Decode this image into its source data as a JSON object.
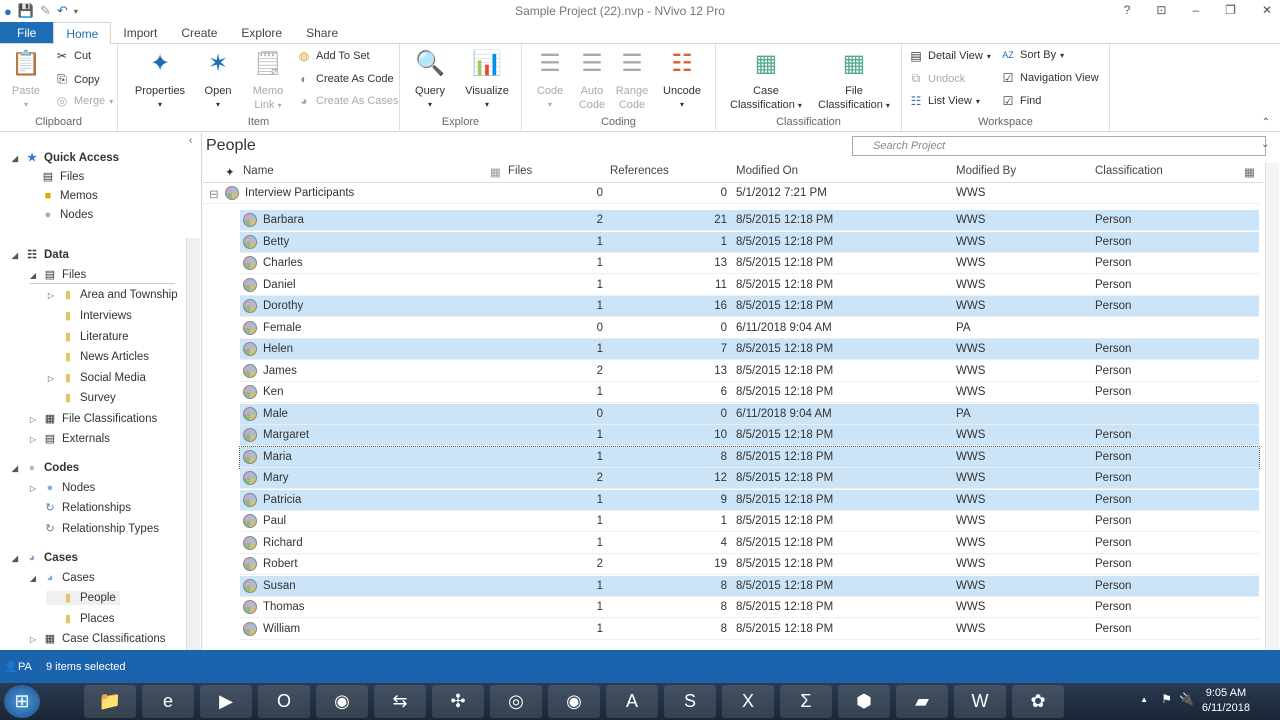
{
  "window": {
    "title": "Sample Project (22).nvp - NVivo 12 Pro",
    "help": "?",
    "minimize": "–",
    "restore": "❐",
    "close": "✕",
    "ribbon_display": "⊡"
  },
  "tabs": [
    "File",
    "Home",
    "Import",
    "Create",
    "Explore",
    "Share"
  ],
  "ribbon": {
    "clipboard": {
      "label": "Clipboard",
      "paste": "Paste",
      "cut": "Cut",
      "copy": "Copy",
      "merge": "Merge"
    },
    "item": {
      "label": "Item",
      "properties": "Properties",
      "open": "Open",
      "memo_link_1": "Memo",
      "memo_link_2": "Link",
      "add_to_set": "Add To Set",
      "create_as_code": "Create As Code",
      "create_as_cases": "Create As Cases"
    },
    "explore": {
      "label": "Explore",
      "query": "Query",
      "visualize": "Visualize"
    },
    "coding": {
      "label": "Coding",
      "code": "Code",
      "auto_code_1": "Auto",
      "auto_code_2": "Code",
      "range_code_1": "Range",
      "range_code_2": "Code",
      "uncode": "Uncode"
    },
    "classification": {
      "label": "Classification",
      "case_1": "Case",
      "case_2": "Classification",
      "file_1": "File",
      "file_2": "Classification"
    },
    "workspace": {
      "label": "Workspace",
      "detail_view": "Detail View",
      "sort_by": "Sort By",
      "undock": "Undock",
      "navigation_view": "Navigation View",
      "list_view": "List View",
      "find": "Find"
    }
  },
  "nav": {
    "quick_access": "Quick Access",
    "qa_files": "Files",
    "qa_memos": "Memos",
    "qa_nodes": "Nodes",
    "data": "Data",
    "files": "Files",
    "folders": [
      "Area and Township",
      "Interviews",
      "Literature",
      "News Articles",
      "Social Media",
      "Survey"
    ],
    "file_classifications": "File Classifications",
    "externals": "Externals",
    "codes": "Codes",
    "nodes": "Nodes",
    "relationships": "Relationships",
    "relationship_types": "Relationship Types",
    "cases": "Cases",
    "cases_sub": "Cases",
    "people": "People",
    "places": "Places",
    "case_classifications": "Case Classifications"
  },
  "main": {
    "title": "People",
    "search_placeholder": "Search Project",
    "columns": [
      "Name",
      "Files",
      "References",
      "Modified On",
      "Modified By",
      "Classification"
    ],
    "parent": {
      "name": "Interview Participants",
      "files": "0",
      "refs": "0",
      "modified_on": "5/1/2012 7:21 PM",
      "modified_by": "WWS",
      "classification": ""
    },
    "rows": [
      {
        "name": "Barbara",
        "files": "2",
        "refs": "21",
        "modified_on": "8/5/2015 12:18 PM",
        "modified_by": "WWS",
        "classification": "Person",
        "selected": true
      },
      {
        "name": "Betty",
        "files": "1",
        "refs": "1",
        "modified_on": "8/5/2015 12:18 PM",
        "modified_by": "WWS",
        "classification": "Person",
        "selected": true
      },
      {
        "name": "Charles",
        "files": "1",
        "refs": "13",
        "modified_on": "8/5/2015 12:18 PM",
        "modified_by": "WWS",
        "classification": "Person",
        "selected": false
      },
      {
        "name": "Daniel",
        "files": "1",
        "refs": "11",
        "modified_on": "8/5/2015 12:18 PM",
        "modified_by": "WWS",
        "classification": "Person",
        "selected": false
      },
      {
        "name": "Dorothy",
        "files": "1",
        "refs": "16",
        "modified_on": "8/5/2015 12:18 PM",
        "modified_by": "WWS",
        "classification": "Person",
        "selected": true
      },
      {
        "name": "Female",
        "files": "0",
        "refs": "0",
        "modified_on": "6/11/2018 9:04 AM",
        "modified_by": "PA",
        "classification": "",
        "selected": false
      },
      {
        "name": "Helen",
        "files": "1",
        "refs": "7",
        "modified_on": "8/5/2015 12:18 PM",
        "modified_by": "WWS",
        "classification": "Person",
        "selected": true
      },
      {
        "name": "James",
        "files": "2",
        "refs": "13",
        "modified_on": "8/5/2015 12:18 PM",
        "modified_by": "WWS",
        "classification": "Person",
        "selected": false
      },
      {
        "name": "Ken",
        "files": "1",
        "refs": "6",
        "modified_on": "8/5/2015 12:18 PM",
        "modified_by": "WWS",
        "classification": "Person",
        "selected": false
      },
      {
        "name": "Male",
        "files": "0",
        "refs": "0",
        "modified_on": "6/11/2018 9:04 AM",
        "modified_by": "PA",
        "classification": "",
        "selected": true
      },
      {
        "name": "Margaret",
        "files": "1",
        "refs": "10",
        "modified_on": "8/5/2015 12:18 PM",
        "modified_by": "WWS",
        "classification": "Person",
        "selected": true
      },
      {
        "name": "Maria",
        "files": "1",
        "refs": "8",
        "modified_on": "8/5/2015 12:18 PM",
        "modified_by": "WWS",
        "classification": "Person",
        "selected": true,
        "focused": true
      },
      {
        "name": "Mary",
        "files": "2",
        "refs": "12",
        "modified_on": "8/5/2015 12:18 PM",
        "modified_by": "WWS",
        "classification": "Person",
        "selected": true
      },
      {
        "name": "Patricia",
        "files": "1",
        "refs": "9",
        "modified_on": "8/5/2015 12:18 PM",
        "modified_by": "WWS",
        "classification": "Person",
        "selected": true
      },
      {
        "name": "Paul",
        "files": "1",
        "refs": "1",
        "modified_on": "8/5/2015 12:18 PM",
        "modified_by": "WWS",
        "classification": "Person",
        "selected": false
      },
      {
        "name": "Richard",
        "files": "1",
        "refs": "4",
        "modified_on": "8/5/2015 12:18 PM",
        "modified_by": "WWS",
        "classification": "Person",
        "selected": false
      },
      {
        "name": "Robert",
        "files": "2",
        "refs": "19",
        "modified_on": "8/5/2015 12:18 PM",
        "modified_by": "WWS",
        "classification": "Person",
        "selected": false
      },
      {
        "name": "Susan",
        "files": "1",
        "refs": "8",
        "modified_on": "8/5/2015 12:18 PM",
        "modified_by": "WWS",
        "classification": "Person",
        "selected": true
      },
      {
        "name": "Thomas",
        "files": "1",
        "refs": "8",
        "modified_on": "8/5/2015 12:18 PM",
        "modified_by": "WWS",
        "classification": "Person",
        "selected": false
      },
      {
        "name": "William",
        "files": "1",
        "refs": "8",
        "modified_on": "8/5/2015 12:18 PM",
        "modified_by": "WWS",
        "classification": "Person",
        "selected": false
      }
    ]
  },
  "status": {
    "user": "PA",
    "selection": "9 items selected"
  },
  "taskbar": {
    "apps": [
      "start",
      "explorer",
      "internet-explorer",
      "media-player",
      "outlook",
      "firefox",
      "app-arrows",
      "app-blue-circle",
      "chromium",
      "chrome",
      "acrobat",
      "skype",
      "excel",
      "math",
      "app-hexagon",
      "sticky-notes",
      "word",
      "app-flower"
    ],
    "time": "9:05 AM",
    "date": "6/11/2018"
  }
}
